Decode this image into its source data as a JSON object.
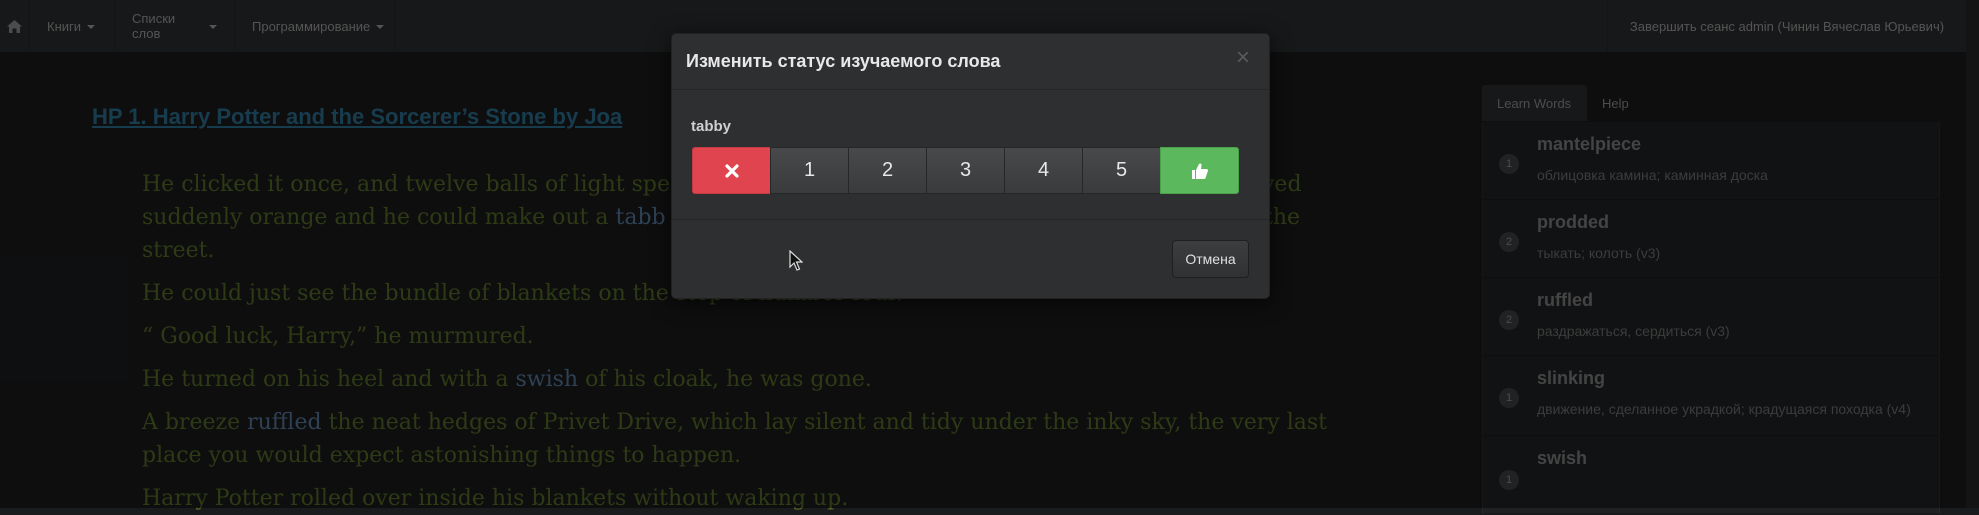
{
  "navbar": {
    "home_icon": "home-icon",
    "menus": [
      {
        "label": "Книги"
      },
      {
        "label": "Списки слов"
      },
      {
        "label": "Программирование"
      }
    ],
    "logout_label": "Завершить сеанс admin (Чинин Вячеслав Юрьевич)"
  },
  "book": {
    "title": "HP 1. Harry Potter and the Sorcerer’s Stone by Joa",
    "paragraphs": [
      {
        "before": "He clicked it once, and twelve balls of light spe",
        "word": "",
        "after": ""
      },
      {
        "before": "suddenly orange and he could make out a ",
        "word": "tabb",
        "after": ""
      },
      {
        "before": "street.",
        "word": "",
        "after": ""
      },
      {
        "before": "He could just see the bundle of blankets on the step of number four.",
        "word": "",
        "after": ""
      },
      {
        "before": "“ Good luck, Harry,” he murmured.",
        "word": "",
        "after": ""
      },
      {
        "before": "He turned on his heel and with a ",
        "word": "swish",
        "after": " of his cloak, he was gone."
      },
      {
        "before": "A breeze ",
        "word": "ruffled",
        "after": " the neat hedges of Privet Drive, which lay silent and tidy under the inky sky, the very last"
      },
      {
        "before": "place you would expect astonishing things to happen.",
        "word": "",
        "after": ""
      },
      {
        "before": "Harry Potter rolled over inside his blankets without waking up.",
        "word": "",
        "after": ""
      }
    ],
    "right_fragments": [
      "ved",
      "the"
    ]
  },
  "sidebar": {
    "tabs": [
      {
        "label": "Learn Words"
      },
      {
        "label": "Help"
      }
    ],
    "words": [
      {
        "level": "1",
        "term": "mantelpiece",
        "translation": "облицовка камина; каминная доска"
      },
      {
        "level": "2",
        "term": "prodded",
        "translation": "тыкать; колоть (v3)"
      },
      {
        "level": "2",
        "term": "ruffled",
        "translation": "раздражаться, сердиться (v3)"
      },
      {
        "level": "1",
        "term": "slinking",
        "translation": "движение, сделанное украдкой; крадущаяся походка (v4)"
      },
      {
        "level": "1",
        "term": "swish",
        "translation": ""
      }
    ]
  },
  "modal": {
    "title": "Изменить статус изучаемого слова",
    "close": "×",
    "word": "tabby",
    "buttons": [
      "1",
      "2",
      "3",
      "4",
      "5"
    ],
    "reject_icon": "close-icon",
    "accept_icon": "thumbs-up-icon",
    "cancel_label": "Отмена"
  },
  "colors": {
    "reject": "#e0454f",
    "accept": "#5cb85c",
    "book_text": "#546a27",
    "highlight": "#557799"
  }
}
